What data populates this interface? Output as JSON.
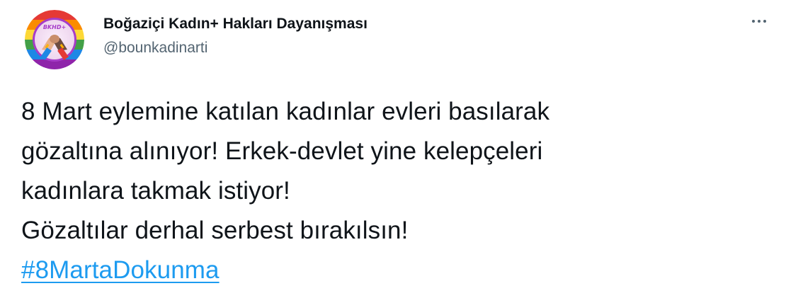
{
  "author": {
    "display_name": "Boğaziçi Kadın+ Hakları Dayanışması",
    "handle": "@bounkadinarti",
    "avatar_text": "BKHD+",
    "avatar_icon": "clasped-hands-rainbow-avatar"
  },
  "menu": {
    "icon": "more-dots-icon"
  },
  "tweet": {
    "lines": [
      "8 Mart eylemine katılan kadınlar evleri basılarak",
      "gözaltına alınıyor! Erkek-devlet yine kelepçeleri",
      "kadınlara takmak istiyor!",
      "Gözaltılar derhal serbest bırakılsın!"
    ],
    "hashtag": "#8MartaDokunma"
  },
  "colors": {
    "text": "#0f1419",
    "secondary": "#536471",
    "link": "#1d9bf0"
  }
}
